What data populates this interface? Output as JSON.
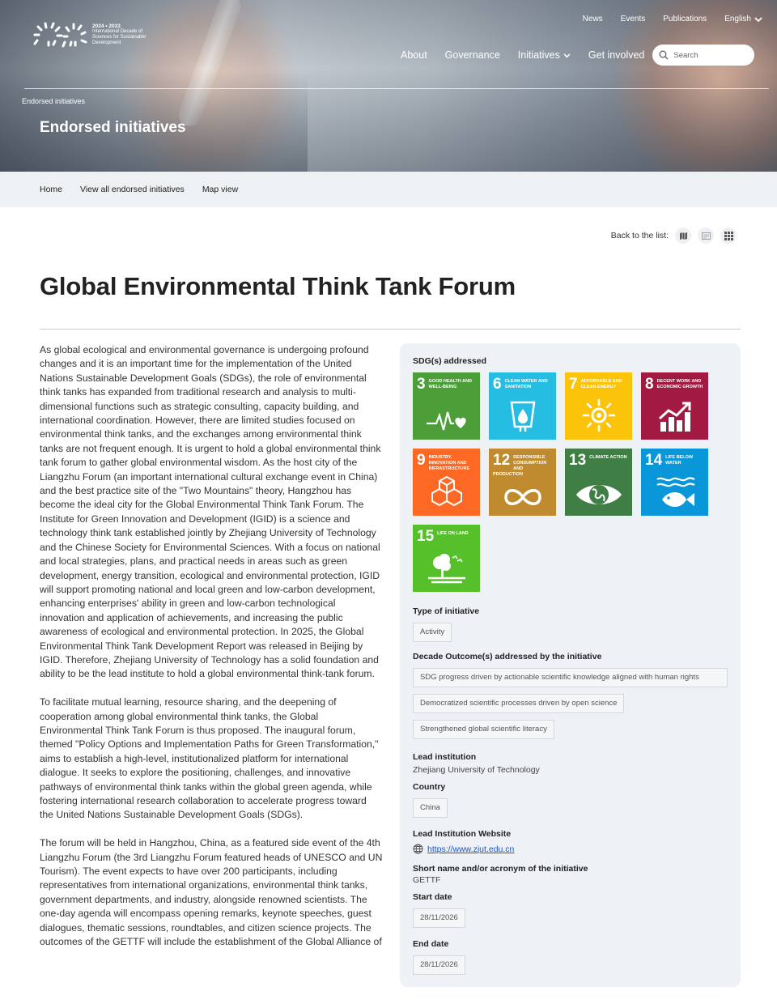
{
  "brand": {
    "years": "2024 • 2033",
    "name": "International Decade of Sciences for Sustainable Development"
  },
  "top_nav": {
    "news": "News",
    "events": "Events",
    "publications": "Publications",
    "language": "English"
  },
  "main_nav": {
    "about": "About",
    "governance": "Governance",
    "initiatives": "Initiatives",
    "get_involved": "Get involved",
    "search_placeholder": "Search"
  },
  "hero": {
    "breadcrumb": "Endorsed initiatives",
    "title": "Endorsed initiatives"
  },
  "subnav": {
    "home": "Home",
    "view_all": "View all endorsed initiatives",
    "map_view": "Map view"
  },
  "back_to_list": "Back to the list:",
  "page_title": "Global Environmental Think Tank Forum",
  "body_paragraphs": [
    "As global ecological and environmental governance is undergoing profound changes and it is an important time for the implementation of the United Nations Sustainable Development Goals (SDGs), the role of environmental think tanks has expanded from traditional research and analysis to multi-dimensional functions such as strategic consulting, capacity building, and international coordination. However, there are limited studies focused on environmental think tanks, and the exchanges among environmental think tanks are not frequent enough. It is urgent to hold a global environmental think tank forum to gather global environmental wisdom. As the host city of the Liangzhu Forum (an important international cultural exchange event in China) and the best practice site of the \"Two Mountains\" theory, Hangzhou has become the ideal city for the Global Environmental Think Tank Forum. The Institute for Green Innovation and Development (IGID) is a science and technology think tank established jointly by Zhejiang University of Technology and the Chinese Society for Environmental Sciences. With a focus on national and local strategies, plans, and practical needs in areas such as green development, energy transition, ecological and environmental protection, IGID will support promoting national and local green and low-carbon development, enhancing enterprises' ability in green and low-carbon technological innovation and application of achievements, and increasing the public awareness of ecological and environmental protection. In 2025, the Global Environmental Think Tank Development Report was released in Beijing by IGID. Therefore, Zhejiang University of Technology has a solid foundation and ability to be the lead institute to hold a global environmental think-tank forum.",
    "To facilitate mutual learning, resource sharing, and the deepening of cooperation among global environmental think tanks, the Global Environmental Think Tank Forum is thus proposed. The inaugural forum, themed \"Policy Options and Implementation Paths for Green Transformation,\" aims to establish a high-level, institutionalized platform for international dialogue. It seeks to explore the positioning, challenges, and innovative pathways of environmental think tanks within the global green agenda, while fostering international research collaboration to accelerate progress toward the United Nations Sustainable Development Goals (SDGs).",
    "The forum will be held in Hangzhou, China, as a featured side event of the 4th Liangzhu Forum (the 3rd Liangzhu Forum featured heads of UNESCO and UN Tourism). The event expects to have over 200 participants, including representatives from international organizations, environmental think tanks, government departments, and industry, alongside renowned scientists. The one-day agenda will encompass opening remarks, keynote speeches, guest dialogues, thematic sessions, roundtables, and citizen science projects. The outcomes of the GETTF will include the establishment of the Global Alliance of"
  ],
  "panel": {
    "sdg_heading": "SDG(s) addressed",
    "sdgs": [
      {
        "num": "3",
        "label": "Good health and well-being",
        "color": "#4c9f38",
        "icon": "heartbeat-icon"
      },
      {
        "num": "6",
        "label": "Clean water and sanitation",
        "color": "#26bde2",
        "icon": "water-drop-icon"
      },
      {
        "num": "7",
        "label": "Affordable and clean energy",
        "color": "#fcc30b",
        "icon": "sun-icon"
      },
      {
        "num": "8",
        "label": "Decent work and economic growth",
        "color": "#a21942",
        "icon": "growth-chart-icon"
      },
      {
        "num": "9",
        "label": "Industry, innovation and infrastructure",
        "color": "#fd6925",
        "icon": "cubes-icon"
      },
      {
        "num": "12",
        "label": "Responsible consumption and production",
        "color": "#bf8b2e",
        "icon": "infinity-icon"
      },
      {
        "num": "13",
        "label": "Climate action",
        "color": "#3f7e44",
        "icon": "earth-eye-icon"
      },
      {
        "num": "14",
        "label": "Life below water",
        "color": "#0a97d9",
        "icon": "fish-icon"
      },
      {
        "num": "15",
        "label": "Life on land",
        "color": "#56c02b",
        "icon": "tree-icon"
      }
    ],
    "type_label": "Type of initiative",
    "type_value": "Activity",
    "outcomes_label": "Decade Outcome(s) addressed by the initiative",
    "outcomes": [
      "SDG progress driven by actionable scientific knowledge aligned with human rights",
      "Democratized scientific processes driven by open science",
      "Strengthened global scientific literacy"
    ],
    "lead_label": "Lead institution",
    "lead_value": "Zhejiang University of Technology",
    "country_label": "Country",
    "country_value": "China",
    "website_label": "Lead Institution Website",
    "website_value": "https://www.zjut.edu.cn",
    "acronym_label": "Short name and/or acronym of the initiative",
    "acronym_value": "GETTF",
    "start_label": "Start date",
    "start_value": "28/11/2026",
    "end_label": "End date",
    "end_value": "28/11/2026"
  }
}
